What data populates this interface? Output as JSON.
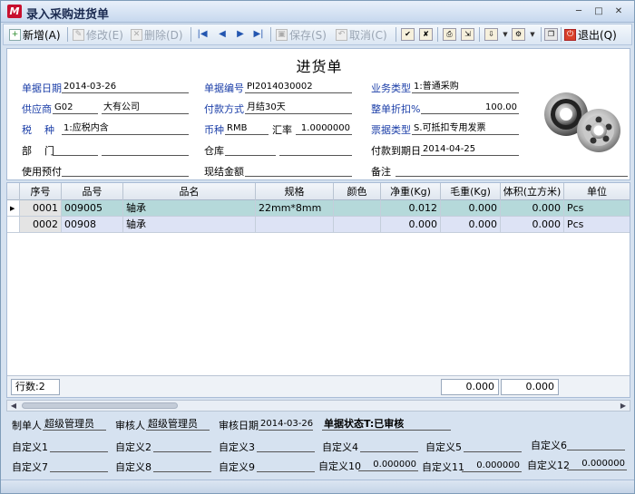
{
  "window": {
    "logo": "M",
    "title": "录入采购进货单"
  },
  "toolbar": {
    "new": "新增(A)",
    "edit": "修改(E)",
    "delete": "删除(D)",
    "save": "保存(S)",
    "cancel": "取消(C)",
    "exit": "退出(Q)"
  },
  "form": {
    "title": "进货单",
    "doc_date_label": "单据日期",
    "doc_date": "2014-03-26",
    "doc_no_label": "单据编号",
    "doc_no": "PI2014030002",
    "biz_type_label": "业务类型",
    "biz_type": "1:普通采购",
    "supplier_label": "供应商",
    "supplier_code": "G02",
    "supplier_name": "大有公司",
    "pay_method_label": "付款方式",
    "pay_method": "月结30天",
    "discount_label": "整单折扣%",
    "discount": "100.00",
    "tax_label": "税    种",
    "tax": "1:应税内含",
    "currency_label": "币种",
    "currency": "RMB",
    "rate_label": "汇率",
    "rate": "1.0000000",
    "invoice_type_label": "票据类型",
    "invoice_type": "S.可抵扣专用发票",
    "dept_label": "部    门",
    "warehouse_label": "仓库",
    "due_date_label": "付款到期日",
    "due_date": "2014-04-25",
    "prepay_label": "使用预付",
    "cash_label": "现结金额",
    "remark_label": "备注"
  },
  "grid": {
    "columns": [
      "序号",
      "品号",
      "品名",
      "规格",
      "颜色",
      "净重(Kg)",
      "毛重(Kg)",
      "体积(立方米)",
      "单位"
    ],
    "rows": [
      {
        "seq": "0001",
        "code": "009005",
        "name": "轴承",
        "spec": "22mm*8mm",
        "color": "",
        "net": "0.012",
        "gross": "0.000",
        "volume": "0.000",
        "unit": "Pcs"
      },
      {
        "seq": "0002",
        "code": "00908",
        "name": "轴承",
        "spec": "",
        "color": "",
        "net": "0.000",
        "gross": "0.000",
        "volume": "0.000",
        "unit": "Pcs"
      }
    ],
    "row_count": "行数:2",
    "sum_gross": "0.000",
    "sum_volume": "0.000"
  },
  "footer": {
    "maker_label": "制单人",
    "maker": "超级管理员",
    "auditor_label": "审核人",
    "auditor": "超级管理员",
    "audit_date_label": "审核日期",
    "audit_date": "2014-03-26",
    "status": "单据状态T:已审核",
    "custom": [
      {
        "label": "自定义1",
        "value": ""
      },
      {
        "label": "自定义2",
        "value": ""
      },
      {
        "label": "自定义3",
        "value": ""
      },
      {
        "label": "自定义4",
        "value": ""
      },
      {
        "label": "自定义5",
        "value": ""
      },
      {
        "label": "自定义6",
        "value": ""
      },
      {
        "label": "自定义7",
        "value": ""
      },
      {
        "label": "自定义8",
        "value": ""
      },
      {
        "label": "自定义9",
        "value": ""
      },
      {
        "label": "自定义10",
        "value": "0.000000"
      },
      {
        "label": "自定义11",
        "value": "0.000000"
      },
      {
        "label": "自定义12",
        "value": "0.000000"
      }
    ]
  }
}
